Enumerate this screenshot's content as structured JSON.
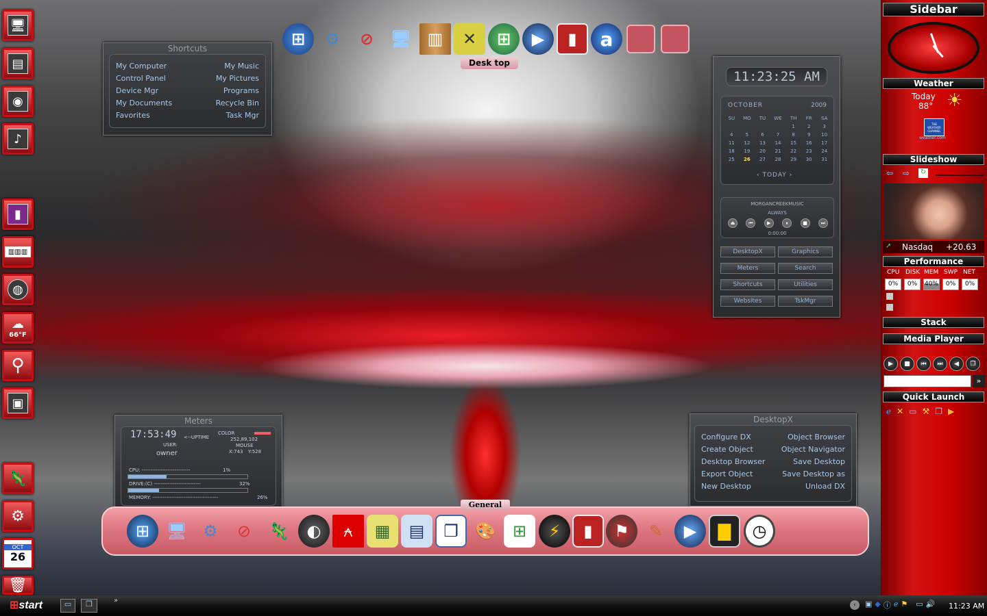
{
  "top_dock": {
    "label": "Desk top",
    "icons": [
      "windows-logo-icon",
      "net-settings-icon",
      "net-disabled-icon",
      "my-computer-icon",
      "wooden-board-icon",
      "crossed-x-icon",
      "windows-orb-icon",
      "media-player-icon",
      "red-book-icon",
      "letter-a-icon",
      "empty-slot-icon",
      "empty-slot-icon"
    ],
    "letter_a": "a"
  },
  "shortcuts": {
    "title": "Shortcuts",
    "left": [
      "My Computer",
      "Control Panel",
      "Device Mgr",
      "My Documents",
      "Favorites"
    ],
    "right": [
      "My Music",
      "My Pictures",
      "Programs",
      "Recycle Bin",
      "Task Mgr"
    ]
  },
  "clock_widget": {
    "time": "11:23:25 AM",
    "month": "OCTOBER",
    "year": "2009",
    "day_headers": [
      "SU",
      "MO",
      "TU",
      "WE",
      "TH",
      "FR",
      "SA"
    ],
    "weeks": [
      [
        "",
        "",
        "",
        "",
        "1",
        "2",
        "3"
      ],
      [
        "4",
        "5",
        "6",
        "7",
        "8",
        "9",
        "10"
      ],
      [
        "11",
        "12",
        "13",
        "14",
        "15",
        "16",
        "17"
      ],
      [
        "18",
        "19",
        "20",
        "21",
        "22",
        "23",
        "24"
      ],
      [
        "25",
        "26",
        "27",
        "28",
        "29",
        "30",
        "31"
      ]
    ],
    "today_label": "TODAY",
    "today_day": "26"
  },
  "mini_player": {
    "line1": "MORGANCREEKMUSIC",
    "line2": "ALWAYS",
    "time": "0:00:00"
  },
  "dx_buttons": [
    "DesktopX",
    "Graphics",
    "Meters",
    "Search",
    "Shortcuts",
    "Utilities",
    "Websites",
    "TskMgr"
  ],
  "meters": {
    "title": "Meters",
    "time": "17:53:49",
    "uptime": "<--UPTIME",
    "user_label": "USER:",
    "user": "owner",
    "color_label": "COLOR",
    "color_value": "252,89,102",
    "mouse_label": "MOUSE",
    "mouse_x": "X:743",
    "mouse_y": "Y:528",
    "cpu_label": "CPU: ----------------------------",
    "cpu_value": "1%",
    "drive_label": "DRIVE:(C) ---------------------------",
    "drive_value": "32%",
    "memory_label": "MEMORY: --------------------------------------",
    "memory_value": "26%",
    "drive_fraction": 0.32,
    "memory_fraction": 0.26
  },
  "desktopx_menu": {
    "title": "DesktopX",
    "left": [
      "Configure DX",
      "Create Object",
      "Desktop Browser",
      "Export Object",
      "New Desktop"
    ],
    "right": [
      "Object Browser",
      "Object Navigator",
      "Save Desktop",
      "Save Desktop as",
      "Unload DX"
    ]
  },
  "general_dock": {
    "label": "General",
    "icons": [
      "windows-orb-icon",
      "my-computer-icon",
      "net-settings-icon",
      "net-disabled-icon",
      "gecko-icon",
      "winamp-icon",
      "acrobat-icon",
      "spreadsheet-icon",
      "document-icon",
      "copy-icon",
      "paint-icon",
      "network-icon",
      "lightning-icon",
      "red-book-icon",
      "flag-icon",
      "brushes-icon",
      "media-player-icon",
      "equalizer-icon",
      "clock-icon"
    ]
  },
  "left_icons": [
    "computer-icon",
    "newspaper-icon",
    "speaker-icon",
    "music-note-icon",
    "media-device-icon",
    "keyboard-icon",
    "globe-icon",
    "weather-icon",
    "search-icon",
    "screenshot-icon",
    "gecko-icon",
    "net-settings-icon",
    "calendar-icon",
    "recycle-bin-icon"
  ],
  "weather_left": "66°F",
  "calendar_left": {
    "month": "OCT",
    "day": "26"
  },
  "sidebar": {
    "title": "Sidebar",
    "weather_title": "Weather",
    "weather_day": "Today",
    "weather_temp": "88°",
    "weather_logo": "THE WEATHER CHANNEL",
    "weather_url": "weather.com",
    "slideshow_title": "Slideshow",
    "nasdaq_label": "Nasdaq",
    "nasdaq_value": "+20.63",
    "performance_title": "Performance",
    "perf_labels": [
      "CPU",
      "DISK",
      "MEM",
      "SWP",
      "NET"
    ],
    "perf_values": [
      "0%",
      "0%",
      "40%",
      "0%",
      "0%"
    ],
    "stack_title": "Stack",
    "media_title": "Media Player",
    "quick_title": "Quick Launch"
  },
  "taskbar": {
    "start": "start",
    "time": "11:23 AM",
    "chevron": "»"
  }
}
